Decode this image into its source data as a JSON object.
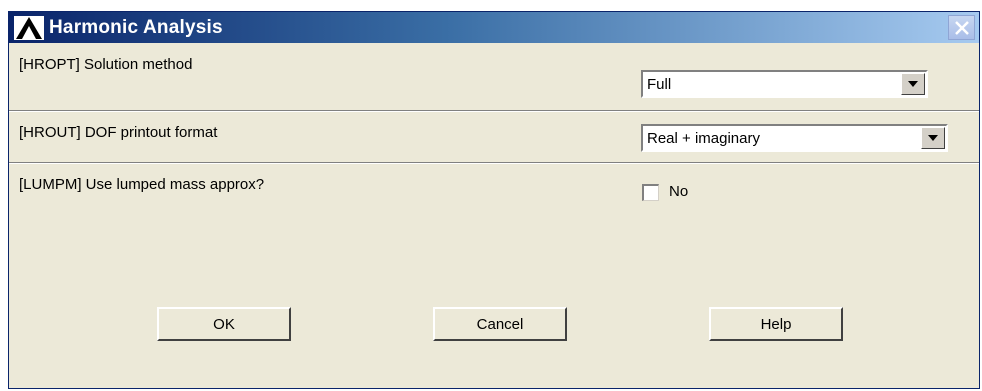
{
  "window": {
    "title": "Harmonic Analysis",
    "icons": {
      "app": "ansys-logo-icon",
      "close": "close-icon"
    }
  },
  "rows": {
    "hropt": {
      "label": "[HROPT]  Solution method",
      "value": "Full"
    },
    "hrout": {
      "label": "[HROUT]  DOF printout format",
      "value": "Real + imaginary"
    },
    "lumpm": {
      "label": "[LUMPM]  Use lumped mass approx?",
      "checkbox_label": "No",
      "checked": false
    }
  },
  "buttons": {
    "ok": "OK",
    "cancel": "Cancel",
    "help": "Help"
  },
  "colors": {
    "title_start": "#0a246a",
    "title_end": "#a6caf0",
    "dialog_bg": "#ece9d8"
  }
}
